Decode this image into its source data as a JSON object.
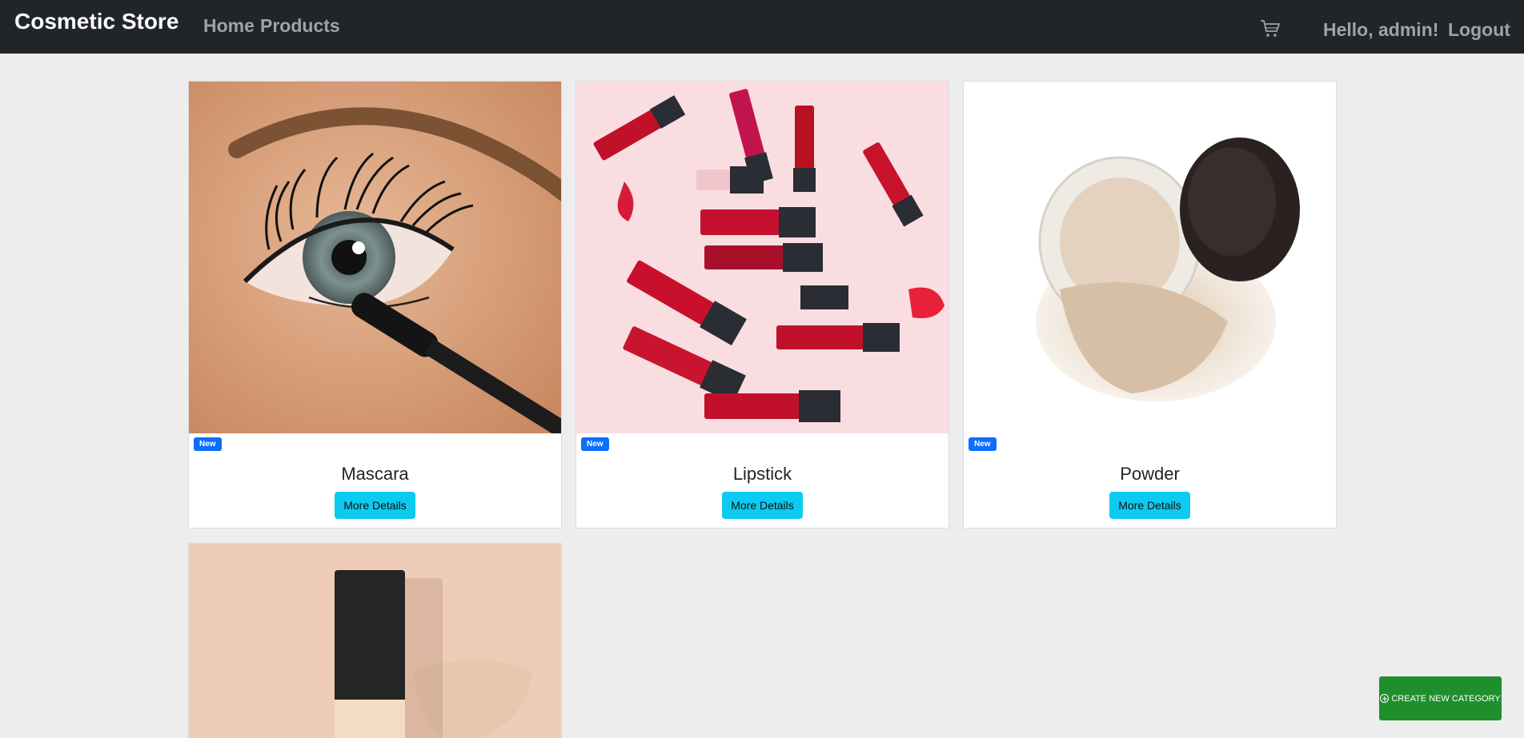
{
  "navbar": {
    "brand": "Cosmetic Store",
    "links": [
      "Home",
      "Products"
    ],
    "cart_icon": "shopping-cart-icon",
    "greeting": "Hello, admin!",
    "logout": "Logout"
  },
  "products": [
    {
      "name": "Mascara",
      "badge": "New",
      "button": "More Details"
    },
    {
      "name": "Lipstick",
      "badge": "New",
      "button": "More Details"
    },
    {
      "name": "Powder",
      "badge": "New",
      "button": "More Details"
    }
  ],
  "create_button": {
    "label": "CREATE NEW CATEGORY",
    "icon": "plus-circle-icon",
    "color": "#1f8f2c"
  },
  "colors": {
    "navbar": "#212529",
    "badge": "#0d6efd",
    "details_button": "#0dcaf0"
  }
}
